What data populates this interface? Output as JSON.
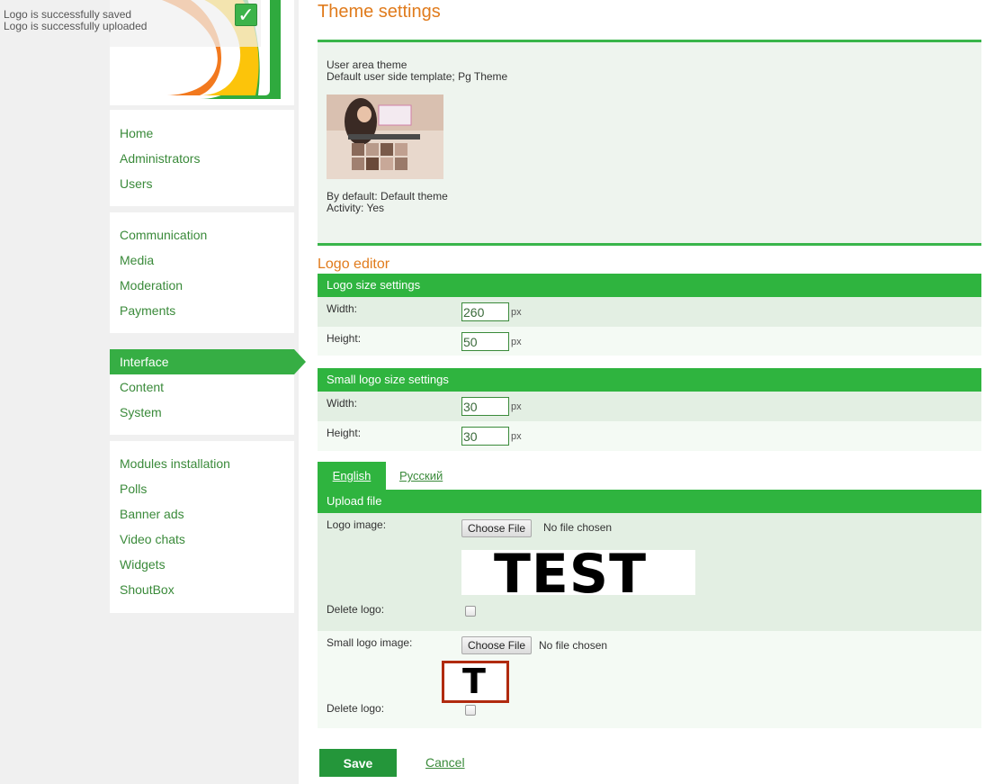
{
  "notification": {
    "messages": [
      "Logo is successfully saved",
      "Logo is successfully uploaded"
    ],
    "icon": "checkmark-icon"
  },
  "sidebar": {
    "groups": [
      {
        "items": [
          "Home",
          "Administrators",
          "Users"
        ]
      },
      {
        "items": [
          "Communication",
          "Media",
          "Moderation",
          "Payments"
        ]
      },
      {
        "items": [
          "Interface",
          "Content",
          "System"
        ],
        "active": "Interface"
      },
      {
        "items": [
          "Modules installation",
          "Polls",
          "Banner ads",
          "Video chats",
          "Widgets",
          "ShoutBox"
        ]
      }
    ]
  },
  "main": {
    "title": "Theme settings",
    "theme": {
      "label": "User area theme",
      "template": "Default user side template; Pg Theme",
      "by_default": "By default: Default theme",
      "activity": "Activity: Yes"
    },
    "logo_editor_title": "Logo editor",
    "logo_size": {
      "header": "Logo size settings",
      "width_label": "Width:",
      "width_value": "260",
      "height_label": "Height:",
      "height_value": "50",
      "unit": "px"
    },
    "small_logo_size": {
      "header": "Small logo size settings",
      "width_label": "Width:",
      "width_value": "30",
      "height_label": "Height:",
      "height_value": "30",
      "unit": "px"
    },
    "tabs": [
      "English",
      "Русский"
    ],
    "upload": {
      "header": "Upload file",
      "logo_image_label": "Logo image:",
      "choose_file": "Choose File",
      "no_file": "No file chosen",
      "logo_preview_text": "TEST",
      "delete_logo_label": "Delete logo:",
      "small_logo_image_label": "Small logo image:",
      "small_logo_preview_text": "T"
    },
    "save_label": "Save",
    "cancel_label": "Cancel"
  },
  "colors": {
    "accent_green": "#2fb43f",
    "title_orange": "#e07b1c",
    "link_green": "#3a8a3a",
    "highlight_border": "#b02a0f"
  }
}
